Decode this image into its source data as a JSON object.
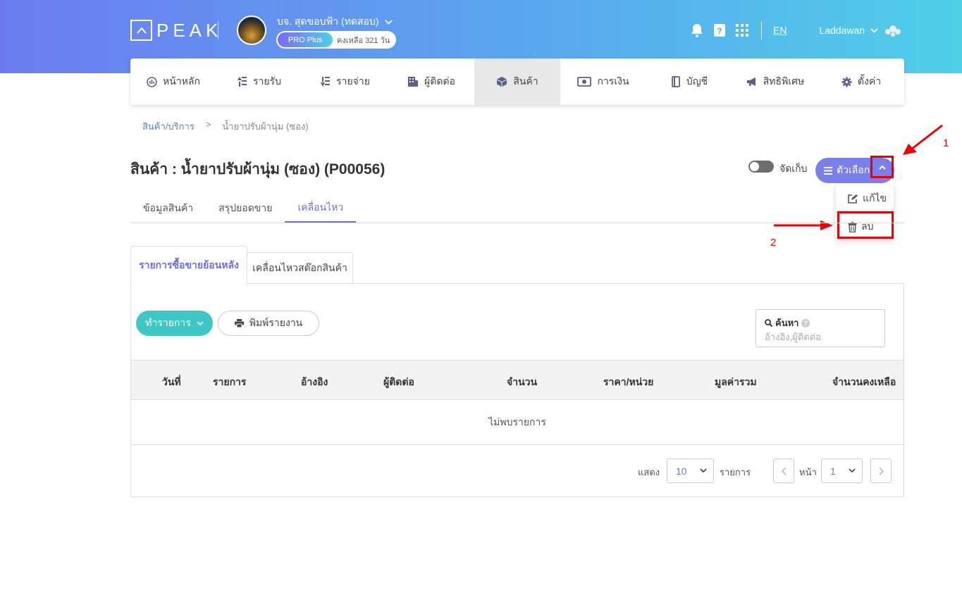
{
  "header": {
    "logo_text": "PEAK",
    "company_name": "บจ. สุดขอบฟ้า (ทดสอบ)",
    "plan_badge": "PRO Plus",
    "plan_remaining": "คงเหลือ 321 วัน",
    "lang": "EN",
    "user_name": "Laddawan"
  },
  "nav": {
    "items": [
      {
        "label": "หน้าหลัก",
        "icon": "dashboard-icon"
      },
      {
        "label": "รายรับ",
        "icon": "income-icon"
      },
      {
        "label": "รายจ่าย",
        "icon": "expense-icon"
      },
      {
        "label": "ผู้ติดต่อ",
        "icon": "contacts-icon"
      },
      {
        "label": "สินค้า",
        "icon": "product-box-icon",
        "active": true
      },
      {
        "label": "การเงิน",
        "icon": "money-icon"
      },
      {
        "label": "บัญชี",
        "icon": "book-icon"
      },
      {
        "label": "สิทธิพิเศษ",
        "icon": "megaphone-icon"
      },
      {
        "label": "ตั้งค่า",
        "icon": "gear-icon"
      }
    ]
  },
  "breadcrumb": {
    "parent": "สินค้า/บริการ",
    "separator": ">",
    "current": "น้ำยาปรับผ้านุ่ม (ซอง)"
  },
  "page": {
    "title": "สินค้า : น้ำยาปรับผ้านุ่ม (ซอง) (P00056)",
    "archive_label": "จัดเก็บ",
    "options_label": "ตัวเลือก"
  },
  "dropdown": {
    "edit_label": "แก้ไข",
    "delete_label": "ลบ"
  },
  "annotations": {
    "step1": "1",
    "step2": "2",
    "highlight_color": "#e00000"
  },
  "tabs": [
    {
      "label": "ข้อมูลสินค้า"
    },
    {
      "label": "สรุปยอดขาย"
    },
    {
      "label": "เคลื่อนไหว",
      "active": true
    }
  ],
  "subtabs": [
    {
      "label": "รายการซื้อขายย้อนหลัง",
      "active": true
    },
    {
      "label": "เคลื่อนไหวสต๊อกสินค้า"
    }
  ],
  "toolbar": {
    "action_label": "ทำรายการ",
    "print_label": "พิมพ์รายงาน"
  },
  "search": {
    "label": "ค้นหา",
    "placeholder": "อ้างอิง,ผู้ติดต่อ"
  },
  "table": {
    "columns": [
      "วันที่",
      "รายการ",
      "อ้างอิง",
      "ผู้ติดต่อ",
      "จำนวน",
      "ราคา/หน่วย",
      "มูลค่ารวม",
      "จำนวนคงเหลือ"
    ],
    "empty_text": "ไม่พบรายการ"
  },
  "pagination": {
    "show_label": "แสดง",
    "page_size": "10",
    "items_label": "รายการ",
    "page_label": "หน้า",
    "page_number": "1"
  },
  "colors": {
    "accent": "#6b6fe0",
    "teal": "#3ec7c4",
    "link": "#5a7fd6"
  }
}
